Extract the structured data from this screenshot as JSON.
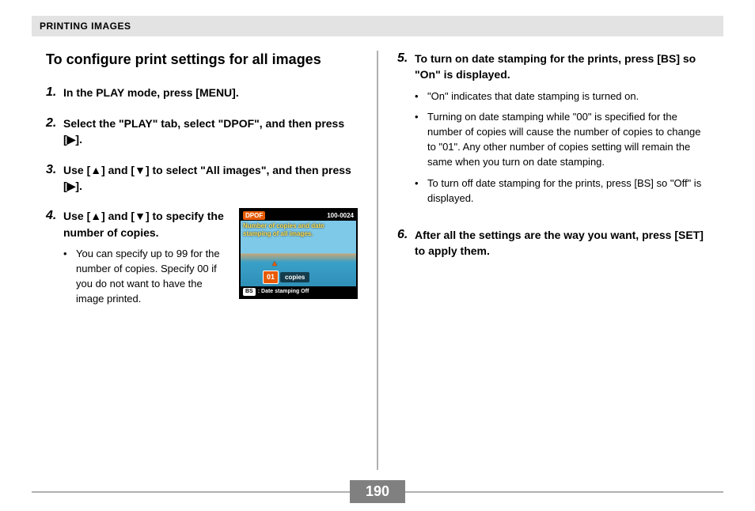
{
  "header": "PRINTING IMAGES",
  "title": "To configure print settings for all images",
  "steps_left": [
    {
      "num": "1.",
      "text": "In the PLAY mode, press [MENU]."
    },
    {
      "num": "2.",
      "text": "Select the \"PLAY\" tab, select \"DPOF\", and then press [▶]."
    },
    {
      "num": "3.",
      "text": "Use [▲] and [▼] to select \"All images\", and then press [▶]."
    },
    {
      "num": "4.",
      "text": "Use [▲] and [▼] to specify the number of copies.",
      "bullets": [
        "You can specify up to 99 for the number of copies. Specify 00 if you do not want to have the image printed."
      ]
    }
  ],
  "steps_right": [
    {
      "num": "5.",
      "text": "To turn on date stamping for the prints, press [BS] so \"On\" is displayed.",
      "bullets": [
        "\"On\" indicates that date stamping is turned on.",
        "Turning on date stamping while \"00\" is specified for the number of copies will cause the number of copies to change to \"01\". Any other number of copies setting will remain the same when you turn on date stamping.",
        "To turn off date stamping for the prints, press [BS] so \"Off\" is displayed."
      ]
    },
    {
      "num": "6.",
      "text": "After all the settings are the way you want, press [SET] to apply them."
    }
  ],
  "screenshot": {
    "dpof": "DPOF",
    "id": "100-0024",
    "msg": "Number of copies and date stamping of all images.",
    "count": "01",
    "copies_label": "copies",
    "bs": "BS",
    "date_stamp": ": Date stamping Off"
  },
  "page_number": "190"
}
